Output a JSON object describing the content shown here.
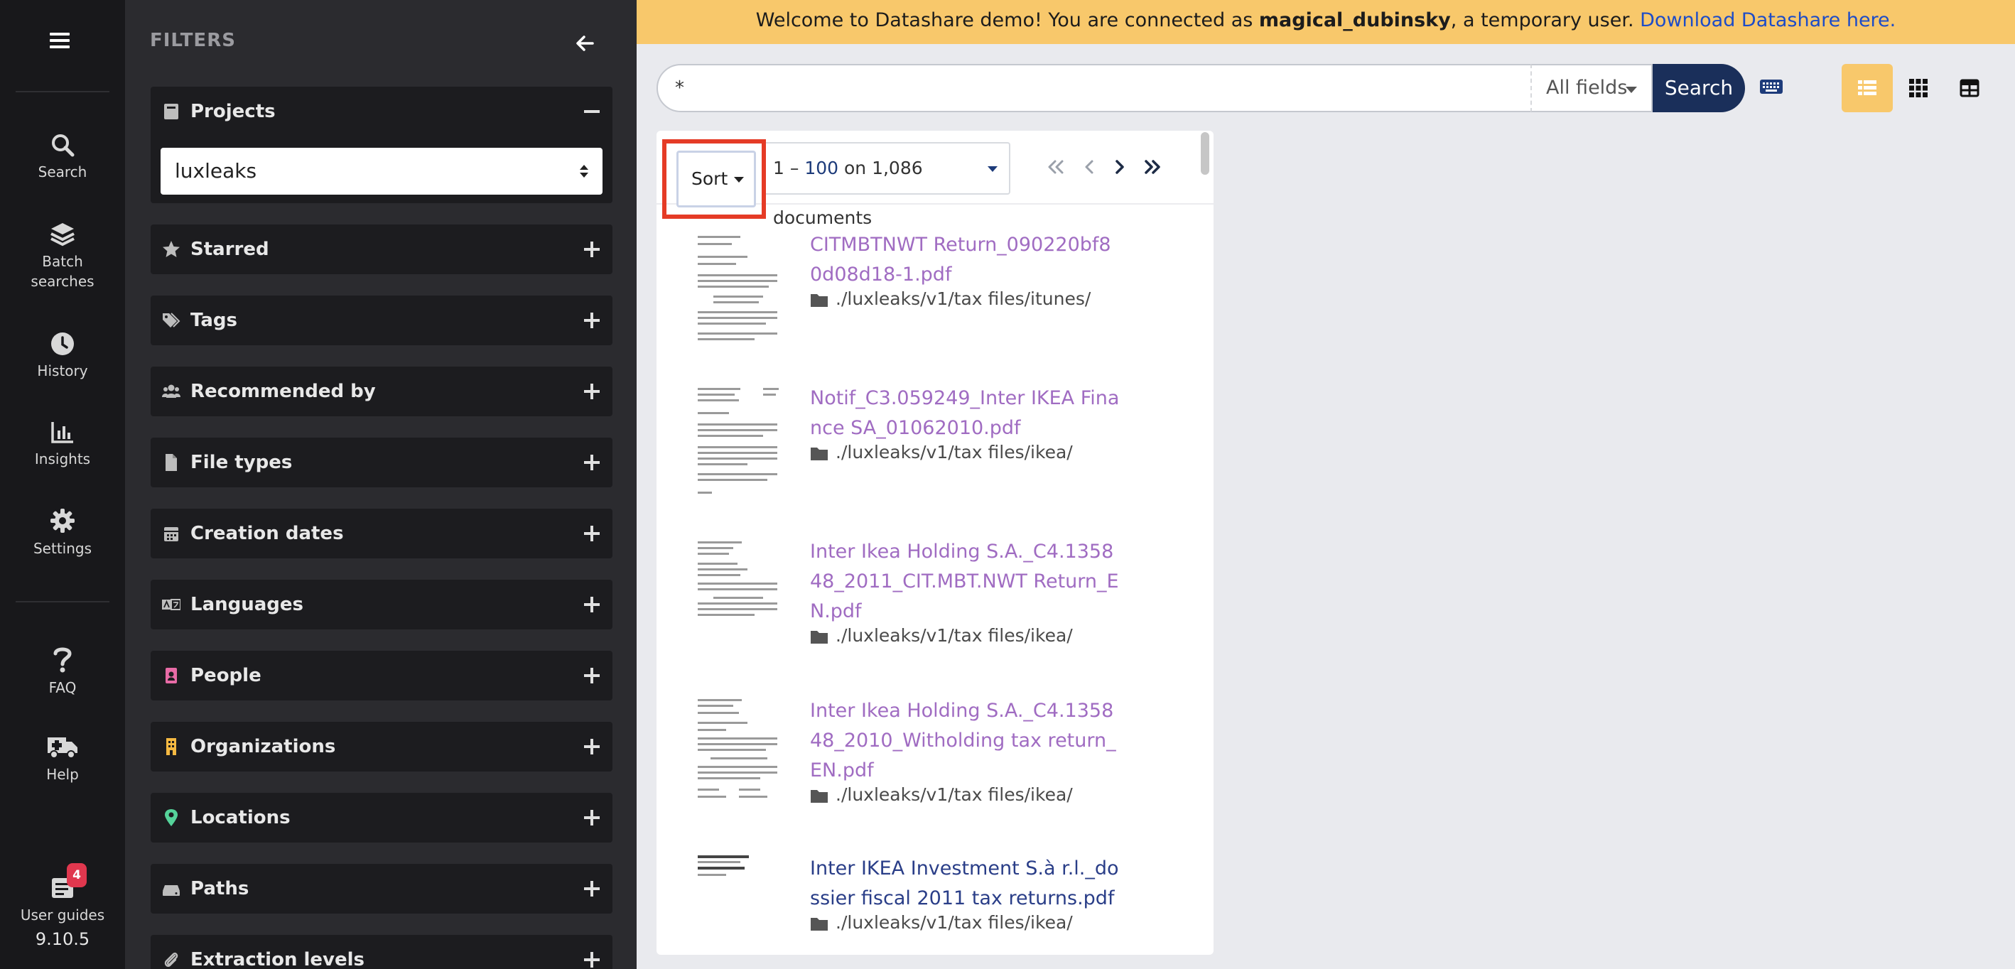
{
  "nav": {
    "items": [
      {
        "label": "Search",
        "icon": "search-icon"
      },
      {
        "label": "Batch searches",
        "icon": "layers-icon"
      },
      {
        "label": "History",
        "icon": "clock-icon"
      },
      {
        "label": "Insights",
        "icon": "bar-chart-icon"
      },
      {
        "label": "Settings",
        "icon": "gear-icon"
      },
      {
        "label": "FAQ",
        "icon": "question-icon"
      },
      {
        "label": "Help",
        "icon": "ambulance-icon"
      },
      {
        "label": "User guides",
        "icon": "book-icon"
      }
    ],
    "user_guides_badge": "4",
    "version": "9.10.5"
  },
  "filters": {
    "title": "FILTERS",
    "projects": {
      "label": "Projects",
      "selected": "luxleaks"
    },
    "panels": [
      {
        "label": "Starred",
        "icon": "star-icon"
      },
      {
        "label": "Tags",
        "icon": "tags-icon"
      },
      {
        "label": "Recommended by",
        "icon": "users-icon"
      },
      {
        "label": "File types",
        "icon": "file-icon"
      },
      {
        "label": "Creation dates",
        "icon": "calendar-icon"
      },
      {
        "label": "Languages",
        "icon": "language-icon"
      },
      {
        "label": "People",
        "icon": "person-badge-icon",
        "color": "#e86ba6"
      },
      {
        "label": "Organizations",
        "icon": "building-icon",
        "color": "#f5b942"
      },
      {
        "label": "Locations",
        "icon": "map-pin-icon",
        "color": "#55d39a"
      },
      {
        "label": "Paths",
        "icon": "hdd-icon"
      },
      {
        "label": "Extraction levels",
        "icon": "paperclip-icon"
      }
    ]
  },
  "banner": {
    "prefix": "Welcome to Datashare demo! You are connected as ",
    "username": "magical_dubinsky",
    "middle": ", a temporary user. ",
    "link": "Download Datashare here."
  },
  "search": {
    "query": "*",
    "fields_label": "All fields",
    "button_label": "Search"
  },
  "results": {
    "sort_label": "Sort",
    "range_prefix": "1 – ",
    "range_end": "100",
    "range_suffix": " on 1,086 documents",
    "documents": [
      {
        "title": "CITMBTNWT Return_090220bf80d08d18-1.pdf",
        "path": "./luxleaks/v1/tax files/itunes/",
        "visited": true
      },
      {
        "title": "Notif_C3.059249_Inter IKEA Finance SA_01062010.pdf",
        "path": "./luxleaks/v1/tax files/ikea/",
        "visited": true
      },
      {
        "title": "Inter Ikea Holding S.A._C4.135848_2011_CIT.MBT.NWT Return_EN.pdf",
        "path": "./luxleaks/v1/tax files/ikea/",
        "visited": true
      },
      {
        "title": "Inter Ikea Holding S.A._C4.135848_2010_Witholding tax return_EN.pdf",
        "path": "./luxleaks/v1/tax files/ikea/",
        "visited": true
      },
      {
        "title": "Inter IKEA Investment S.à r.l._dossier fiscal 2011 tax returns.pdf",
        "path": "./luxleaks/v1/tax files/ikea/",
        "visited": false
      }
    ]
  },
  "colors": {
    "banner": "#f8c86b",
    "search_button": "#1a2f5a",
    "visited_link": "#a06cc2",
    "link": "#2a3e88",
    "highlight": "#e53b26"
  }
}
